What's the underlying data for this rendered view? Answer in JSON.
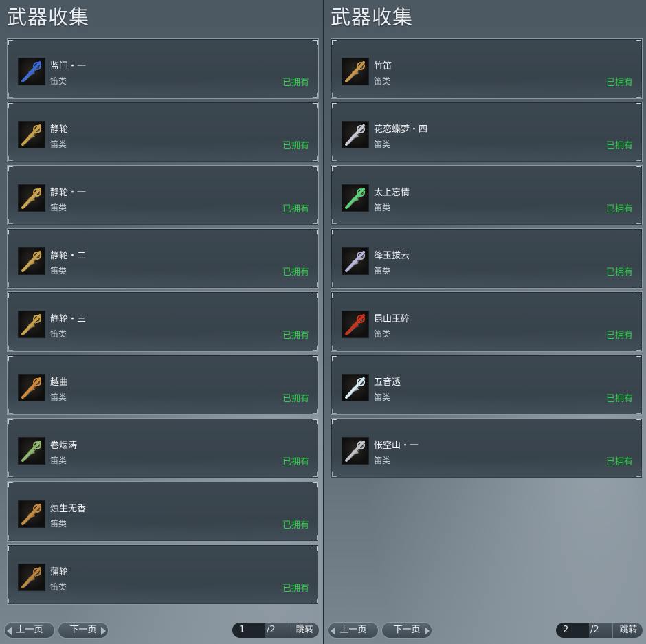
{
  "colors": {
    "owned": "#2fcf4a",
    "panel_bg": "#4c5862",
    "card_bg": "#3c4750"
  },
  "panels": [
    {
      "title": "武器收集",
      "items": [
        {
          "name": "监门・一",
          "type": "笛类",
          "status": "已拥有",
          "icon": "blue-crystal-flute-icon",
          "color": "#3a6bd8"
        },
        {
          "name": "静轮",
          "type": "笛类",
          "status": "已拥有",
          "icon": "gold-claw-flute-icon",
          "color": "#c9a24a"
        },
        {
          "name": "静轮・一",
          "type": "笛类",
          "status": "已拥有",
          "icon": "gold-claw-flute-icon",
          "color": "#c9a24a"
        },
        {
          "name": "静轮・二",
          "type": "笛类",
          "status": "已拥有",
          "icon": "gold-claw-flute-icon",
          "color": "#c9a24a"
        },
        {
          "name": "静轮・三",
          "type": "笛类",
          "status": "已拥有",
          "icon": "gold-claw-flute-icon",
          "color": "#c9a24a"
        },
        {
          "name": "越曲",
          "type": "笛类",
          "status": "已拥有",
          "icon": "copper-spear-flute-icon",
          "color": "#d08a3a"
        },
        {
          "name": "卷烟涛",
          "type": "笛类",
          "status": "已拥有",
          "icon": "jade-dragon-flute-icon",
          "color": "#8fb86a"
        },
        {
          "name": "烛生无香",
          "type": "笛类",
          "status": "已拥有",
          "icon": "bronze-ornate-flute-icon",
          "color": "#c58a3c"
        },
        {
          "name": "蒲轮",
          "type": "笛类",
          "status": "已拥有",
          "icon": "bronze-wheel-flute-icon",
          "color": "#b8843e"
        }
      ],
      "pager": {
        "prev": "上一页",
        "next": "下一页",
        "page": "1",
        "total": "/2",
        "jump": "跳转"
      }
    },
    {
      "title": "武器收集",
      "items": [
        {
          "name": "竹笛",
          "type": "笛类",
          "status": "已拥有",
          "icon": "bamboo-flute-icon",
          "color": "#c8964a"
        },
        {
          "name": "花恋蝶梦・四",
          "type": "笛类",
          "status": "已拥有",
          "icon": "silver-butterfly-flute-icon",
          "color": "#c9ccd6"
        },
        {
          "name": "太上忘情",
          "type": "笛类",
          "status": "已拥有",
          "icon": "green-silver-flute-icon",
          "color": "#5fd07a"
        },
        {
          "name": "绛玉拔云",
          "type": "笛类",
          "status": "已拥有",
          "icon": "silver-serpent-flute-icon",
          "color": "#b6b4d8"
        },
        {
          "name": "昆山玉碎",
          "type": "笛类",
          "status": "已拥有",
          "icon": "red-phoenix-flute-icon",
          "color": "#c8321e"
        },
        {
          "name": "五音透",
          "type": "笛类",
          "status": "已拥有",
          "icon": "ice-crystal-flute-icon",
          "color": "#d6eef4"
        },
        {
          "name": "怅空山・一",
          "type": "笛类",
          "status": "已拥有",
          "icon": "silver-blade-flute-icon",
          "color": "#c0c4c8"
        }
      ],
      "pager": {
        "prev": "上一页",
        "next": "下一页",
        "page": "2",
        "total": "/2",
        "jump": "跳转"
      }
    }
  ]
}
